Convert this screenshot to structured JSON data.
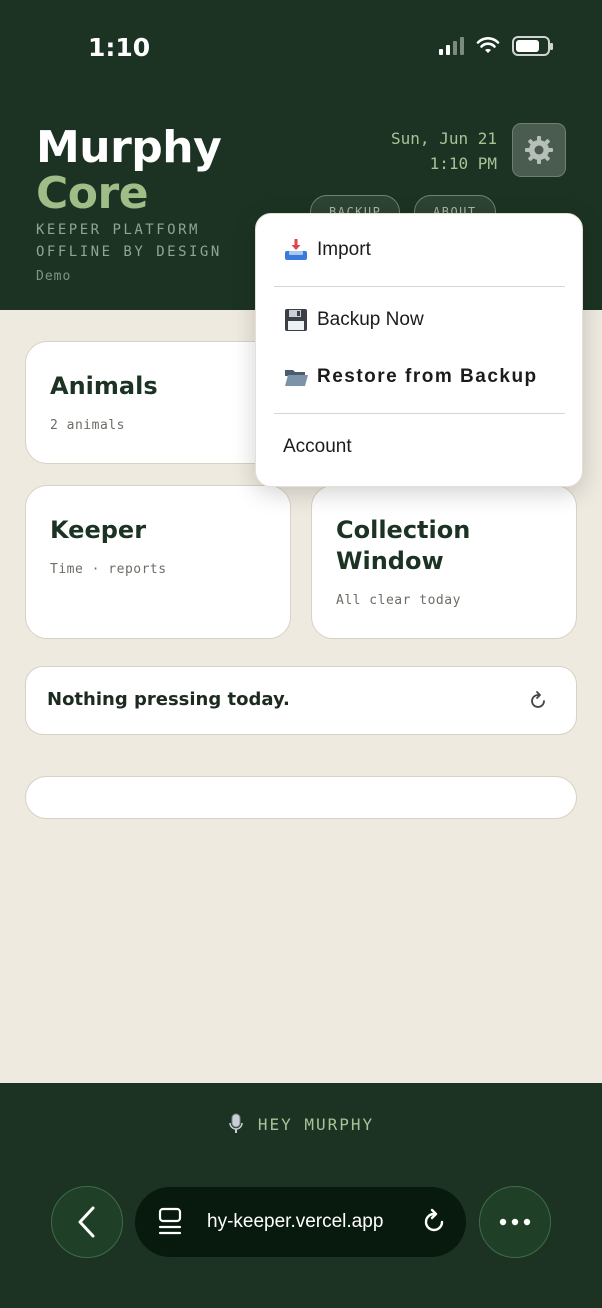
{
  "status_bar": {
    "time": "1:10"
  },
  "header": {
    "brand_line1": "Murphy",
    "brand_line2": "Core",
    "subtitle1": "KEEPER PLATFORM",
    "subtitle2": "OFFLINE BY DESIGN",
    "mode": "Demo",
    "date": "Sun, Jun 21",
    "time": "1:10 PM",
    "pill_backup": "BACKUP",
    "pill_about": "ABOUT"
  },
  "cards": {
    "animals": {
      "title": "Animals",
      "subtitle": "2 animals"
    },
    "keeper": {
      "title": "Keeper",
      "subtitle": "Time · reports"
    },
    "collection": {
      "title_line1": "Collection",
      "title_line2": "Window",
      "subtitle": "All clear today"
    }
  },
  "banner": {
    "text": "Nothing pressing today."
  },
  "menu": {
    "import": "Import",
    "backup_now": "Backup Now",
    "restore": "Restore from Backup",
    "account": "Account"
  },
  "footer": {
    "hey_label": "HEY MURPHY",
    "url": "hy-keeper.vercel.app"
  },
  "colors": {
    "header_bg": "#1c3323",
    "accent_green": "#9fbd86",
    "page_bg": "#efeae0"
  },
  "icons": [
    "gear-icon",
    "inbox-tray-icon",
    "floppy-disk-icon",
    "open-folder-icon",
    "refresh-icon",
    "microphone-icon",
    "chevron-left-icon",
    "tabs-icon",
    "reload-icon",
    "more-icon",
    "signal-icon",
    "wifi-icon",
    "battery-icon"
  ]
}
